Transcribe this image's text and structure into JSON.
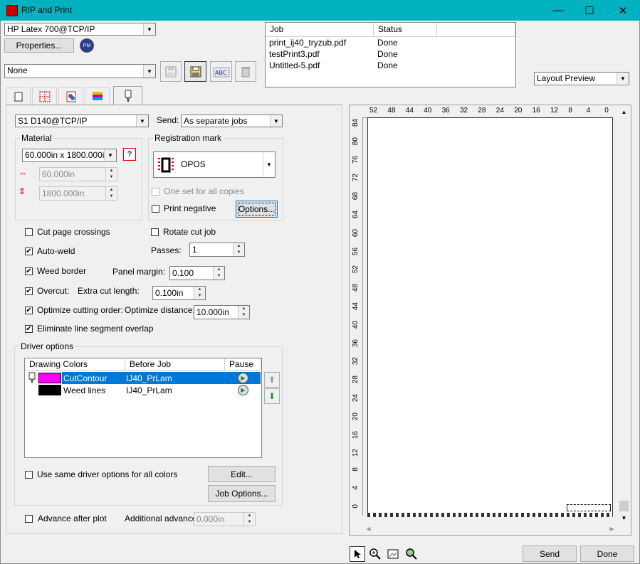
{
  "window": {
    "title": "RIP and Print",
    "minimize": "—",
    "maximize": "☐",
    "close": "✕"
  },
  "top": {
    "printer": "HP Latex 700@TCP/IP",
    "properties_label": "Properties...",
    "preset": "None",
    "toolbar_icons": [
      "save-icon",
      "save-as-icon",
      "spell-check-icon",
      "delete-icon"
    ]
  },
  "jobs": {
    "columns": [
      "Job",
      "Status"
    ],
    "rows": [
      {
        "job": "print_ij40_tryzub.pdf",
        "status": "Done"
      },
      {
        "job": "testPrint3.pdf",
        "status": "Done"
      },
      {
        "job": "Untitled-5.pdf",
        "status": "Done"
      }
    ]
  },
  "preview": {
    "mode": "Layout Preview"
  },
  "tabs": [
    "layout-tab-icon",
    "tiling-tab-icon",
    "color-tab-icon",
    "marks-tab-icon",
    "cut-tab-icon"
  ],
  "cutter": {
    "device": "S1 D140@TCP/IP",
    "send_label": "Send:",
    "send_value": "As separate jobs"
  },
  "material": {
    "label": "Material",
    "size": "60.000in x 1800.000in",
    "width": "60.000in",
    "length": "1800.000in"
  },
  "registration": {
    "label": "Registration mark",
    "mark": "OPOS",
    "one_set_label": "One set for all copies",
    "print_negative_label": "Print negative",
    "options_label": "Options..."
  },
  "options": {
    "cut_page_crossings": {
      "label": "Cut page crossings",
      "checked": false
    },
    "rotate_cut_job": {
      "label": "Rotate cut job",
      "checked": false
    },
    "auto_weld": {
      "label": "Auto-weld",
      "checked": true
    },
    "passes_label": "Passes:",
    "passes": "1",
    "weed_border": {
      "label": "Weed border",
      "checked": true
    },
    "panel_margin_label": "Panel margin:",
    "panel_margin": "0.100",
    "overcut": {
      "label": "Overcut:",
      "checked": true
    },
    "extra_cut_label": "Extra cut length:",
    "extra_cut": "0.100in",
    "optimize_order": {
      "label": "Optimize cutting order:",
      "checked": true
    },
    "optimize_distance_label": "Optimize distance:",
    "optimize_distance": "10.000in",
    "eliminate_overlap": {
      "label": "Eliminate line segment overlap",
      "checked": true
    }
  },
  "driver": {
    "label": "Driver options",
    "columns": [
      "Drawing Colors",
      "Before Job",
      "Pause"
    ],
    "rows": [
      {
        "color_name": "CutContour",
        "color_hex": "#ff00ff",
        "before_job": "IJ40_PrLam",
        "selected": true
      },
      {
        "color_name": "Weed lines",
        "color_hex": "#000000",
        "before_job": "IJ40_PrLam",
        "selected": false
      }
    ],
    "same_options_label": "Use same driver options for all colors",
    "edit_label": "Edit...",
    "job_options_label": "Job Options..."
  },
  "advance": {
    "label": "Advance after plot",
    "additional_label": "Additional advance:",
    "additional_value": "0.000in"
  },
  "ruler": {
    "top_ticks": [
      "52",
      "48",
      "44",
      "40",
      "36",
      "32",
      "28",
      "24",
      "20",
      "16",
      "12",
      "8",
      "4",
      "0"
    ],
    "left_ticks": [
      "84",
      "80",
      "76",
      "72",
      "68",
      "64",
      "60",
      "56",
      "52",
      "48",
      "44",
      "40",
      "36",
      "32",
      "28",
      "24",
      "20",
      "16",
      "12",
      "8",
      "4",
      "0"
    ]
  },
  "bottom": {
    "tool_icons": [
      "pointer-icon",
      "zoom-in-icon",
      "fit-page-icon",
      "zoom-icon"
    ],
    "send_label": "Send",
    "done_label": "Done"
  },
  "colors": {
    "titlebar": "#00b2bf",
    "selection": "#0078d7"
  }
}
